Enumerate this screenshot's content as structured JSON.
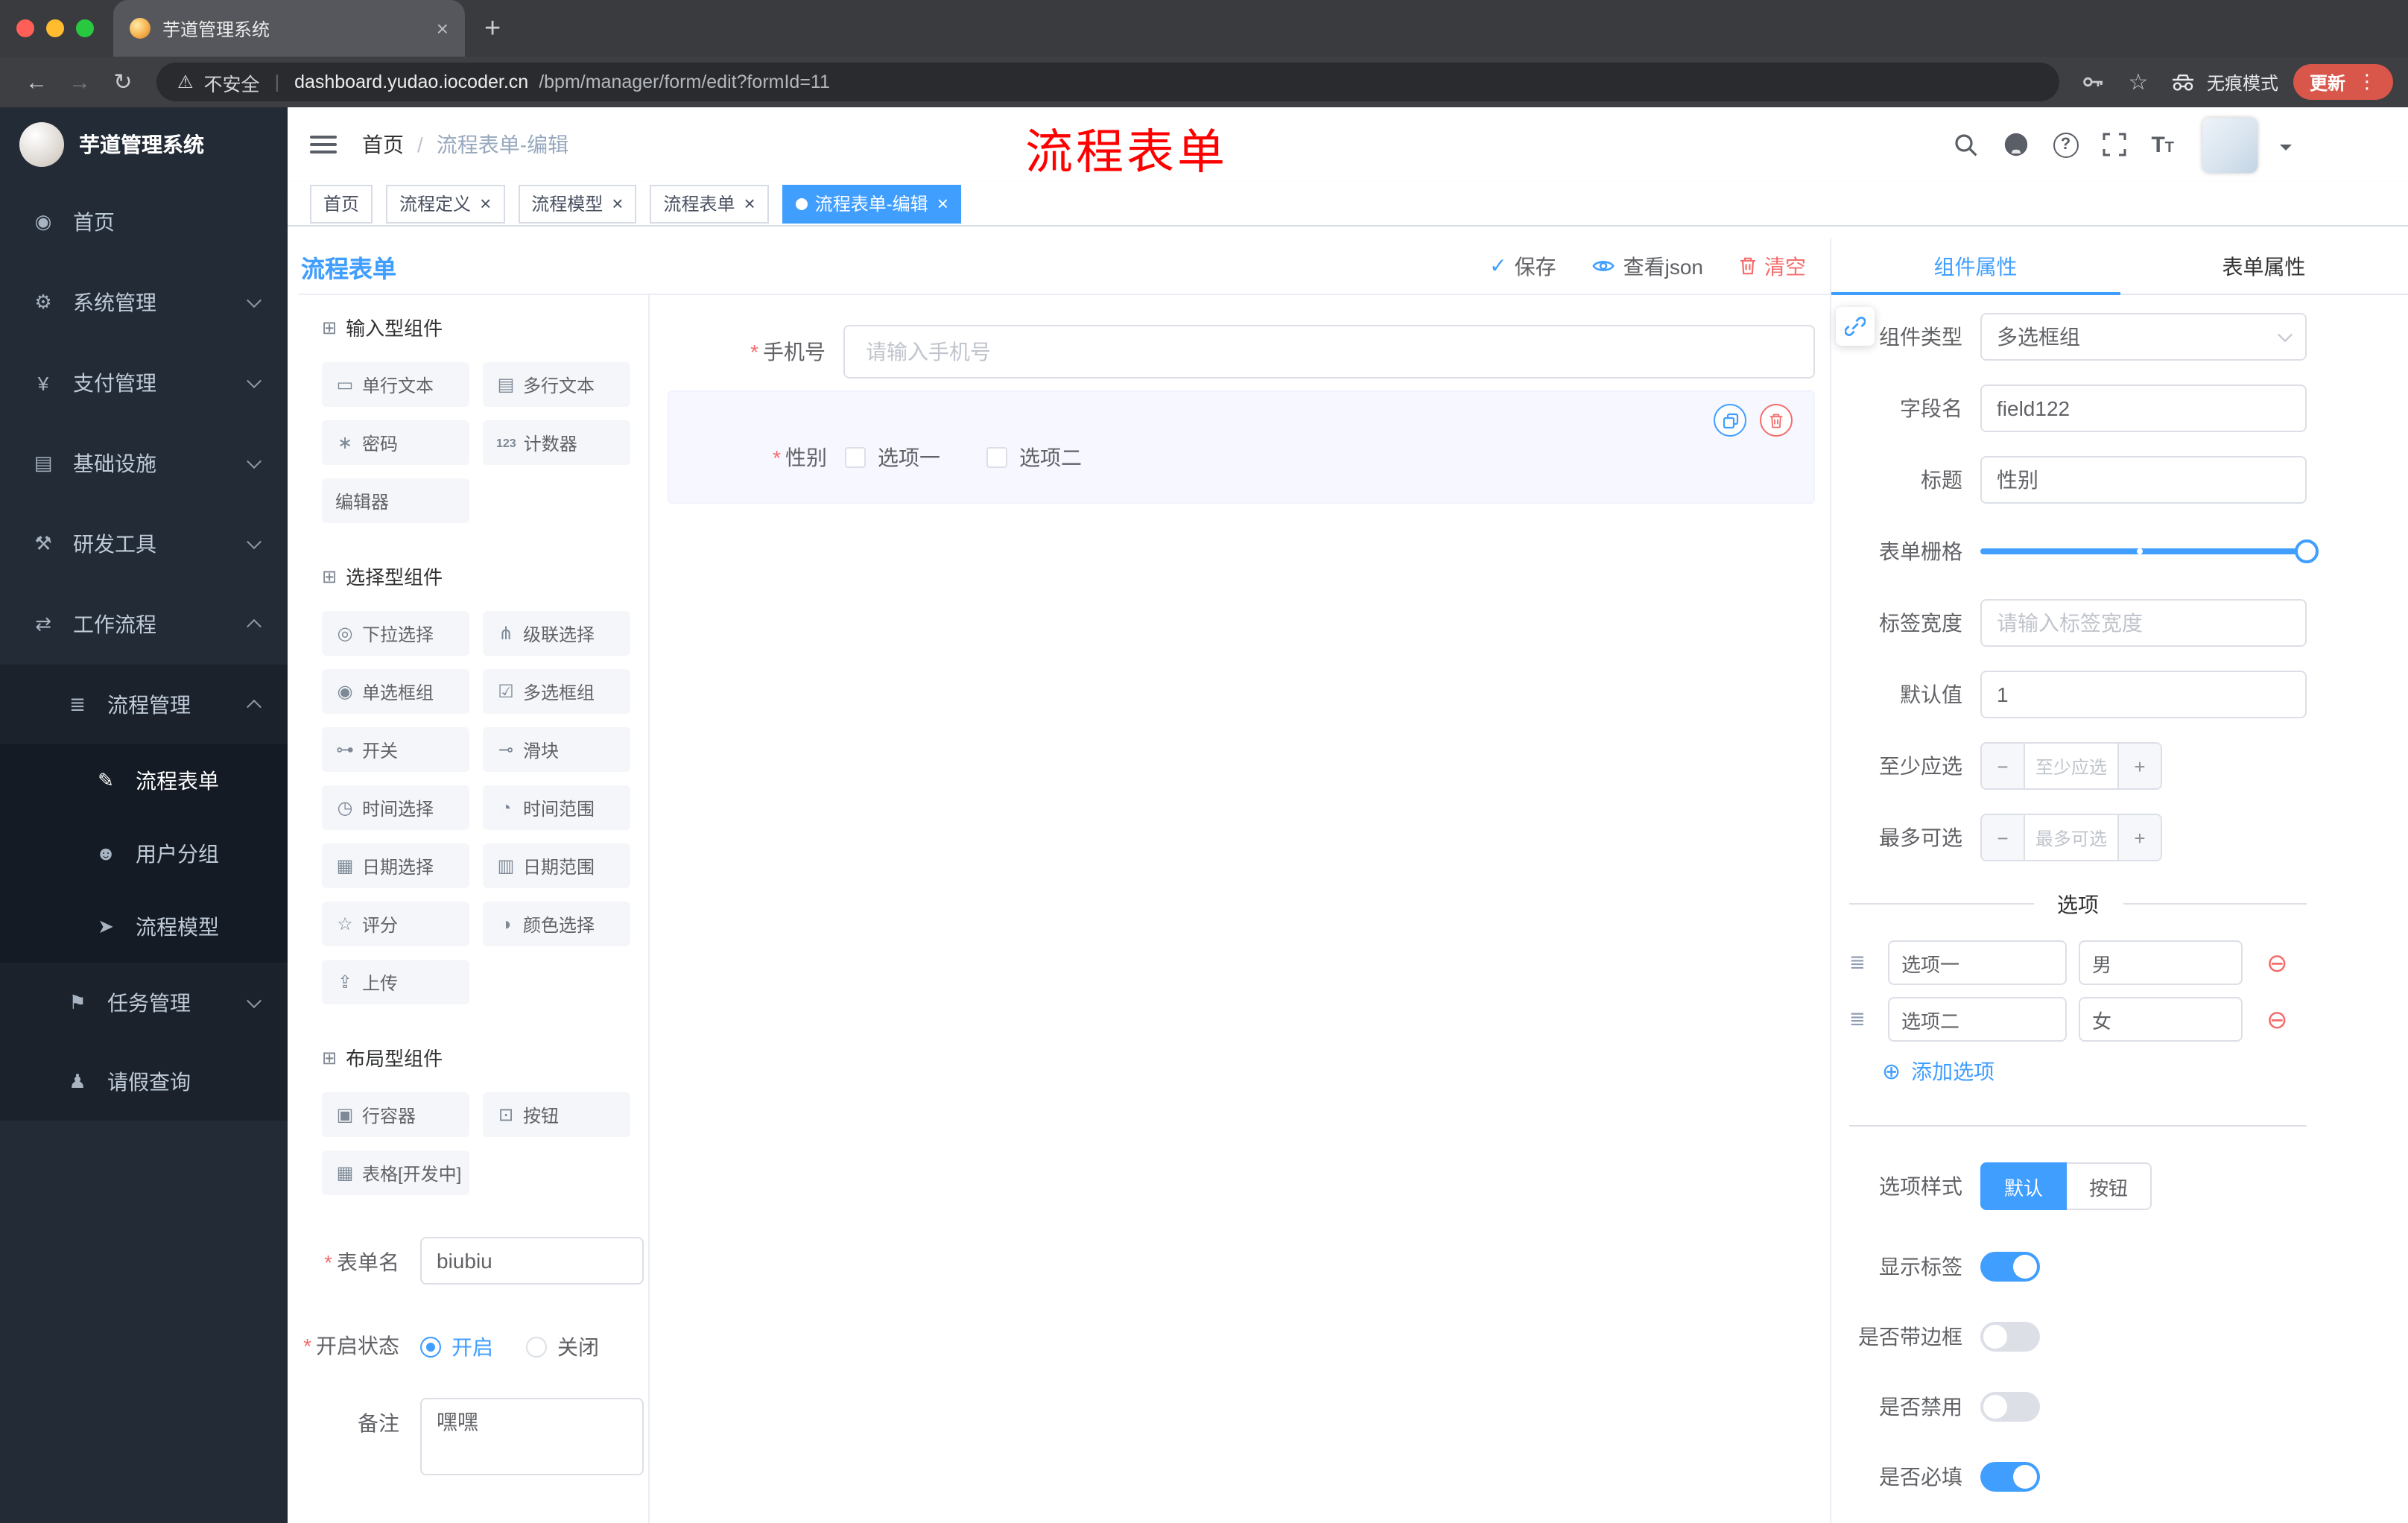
{
  "colors": {
    "accent": "#409EFF",
    "danger": "#F56C6C",
    "annotation": "#FF0000",
    "sidebar_bg": "#232B37"
  },
  "glyphs": {
    "back": "←",
    "forward": "→",
    "reload": "↻",
    "warning": "⚠",
    "pipe": "|",
    "star": "☆",
    "dots": "⋮",
    "new_tab": "+",
    "close": "×",
    "check": "✓",
    "question": "?",
    "minus": "−",
    "plus": "+",
    "add_circle": "⊕",
    "remove_circle": "⊖",
    "required": "*",
    "font_big": "T",
    "font_small": "T",
    "handle": "≣"
  },
  "browser": {
    "tab": {
      "title": "芋道管理系统"
    },
    "toolbar": {
      "security": "不安全",
      "url_domain": "dashboard.yudao.iocoder.cn",
      "url_path": "/bpm/manager/form/edit?formId=11",
      "incognito": "无痕模式",
      "update": "更新"
    }
  },
  "sidebar": {
    "brand": "芋道管理系统",
    "menu": [
      {
        "key": "home",
        "label": "首页",
        "icon": "◉",
        "icon_name": "dashboard-icon",
        "level": 1
      },
      {
        "key": "system",
        "label": "系统管理",
        "icon": "⚙",
        "icon_name": "gear-icon",
        "level": 1,
        "chevron": "down"
      },
      {
        "key": "payment",
        "label": "支付管理",
        "icon": "¥",
        "icon_name": "yen-icon",
        "level": 1,
        "chevron": "down"
      },
      {
        "key": "infrastructure",
        "label": "基础设施",
        "icon": "▤",
        "icon_name": "infrastructure-icon",
        "level": 1,
        "chevron": "down"
      },
      {
        "key": "dev-tools",
        "label": "研发工具",
        "icon": "⚒",
        "icon_name": "tools-icon",
        "level": 1,
        "chevron": "down"
      },
      {
        "key": "workflow",
        "label": "工作流程",
        "icon": "⇄",
        "icon_name": "workflow-icon",
        "level": 1,
        "chevron": "up"
      },
      {
        "key": "process-management",
        "label": "流程管理",
        "icon": "≣",
        "icon_name": "process-list-icon",
        "level": 2,
        "chevron": "up"
      },
      {
        "key": "process-form",
        "label": "流程表单",
        "icon": "✎",
        "icon_name": "form-icon",
        "level": 3,
        "active": true
      },
      {
        "key": "user-group",
        "label": "用户分组",
        "icon": "☻",
        "icon_name": "user-group-icon",
        "level": 3
      },
      {
        "key": "process-model",
        "label": "流程模型",
        "icon": "➤",
        "icon_name": "model-icon",
        "level": 3
      },
      {
        "key": "task-management",
        "label": "任务管理",
        "icon": "⚑",
        "icon_name": "task-icon",
        "level": 2,
        "chevron": "down"
      },
      {
        "key": "leave-query",
        "label": "请假查询",
        "icon": "♟",
        "icon_name": "person-icon",
        "level": 2
      }
    ]
  },
  "header": {
    "breadcrumb_home": "首页",
    "breadcrumb_sep": "/",
    "breadcrumb_current": "流程表单-编辑",
    "annotation": "流程表单"
  },
  "tags": [
    {
      "label": "首页",
      "closable": false,
      "active": false
    },
    {
      "label": "流程定义",
      "closable": true,
      "active": false
    },
    {
      "label": "流程模型",
      "closable": true,
      "active": false
    },
    {
      "label": "流程表单",
      "closable": true,
      "active": false
    },
    {
      "label": "流程表单-编辑",
      "closable": true,
      "active": true
    }
  ],
  "designer": {
    "title": "流程表单",
    "actions": {
      "save": "保存",
      "view_json": "查看json",
      "clear": "清空"
    },
    "palette_icon": "⊞",
    "palette": [
      {
        "title": "输入型组件",
        "items": [
          {
            "label": "单行文本",
            "icon": "▭",
            "icon_name": "single-line-text-icon"
          },
          {
            "label": "多行文本",
            "icon": "▤",
            "icon_name": "textarea-icon"
          },
          {
            "label": "密码",
            "icon": "∗",
            "icon_name": "password-icon"
          },
          {
            "label": "计数器",
            "icon": "123",
            "icon_name": "counter-icon"
          },
          {
            "label": "编辑器",
            "icon": "",
            "icon_name": "editor-icon"
          }
        ]
      },
      {
        "title": "选择型组件",
        "items": [
          {
            "label": "下拉选择",
            "icon": "◎",
            "icon_name": "select-icon"
          },
          {
            "label": "级联选择",
            "icon": "⋔",
            "icon_name": "cascader-icon"
          },
          {
            "label": "单选框组",
            "icon": "◉",
            "icon_name": "radio-group-icon"
          },
          {
            "label": "多选框组",
            "icon": "☑",
            "icon_name": "checkbox-group-icon"
          },
          {
            "label": "开关",
            "icon": "⊶",
            "icon_name": "switch-icon"
          },
          {
            "label": "滑块",
            "icon": "⊸",
            "icon_name": "slider-icon"
          },
          {
            "label": "时间选择",
            "icon": "◷",
            "icon_name": "time-picker-icon"
          },
          {
            "label": "时间范围",
            "icon": "◔",
            "icon_name": "time-range-icon"
          },
          {
            "label": "日期选择",
            "icon": "▦",
            "icon_name": "date-picker-icon"
          },
          {
            "label": "日期范围",
            "icon": "▥",
            "icon_name": "date-range-icon"
          },
          {
            "label": "评分",
            "icon": "☆",
            "icon_name": "rate-icon"
          },
          {
            "label": "颜色选择",
            "icon": "◑",
            "icon_name": "color-picker-icon"
          },
          {
            "label": "上传",
            "icon": "⇪",
            "icon_name": "upload-icon"
          }
        ]
      },
      {
        "title": "布局型组件",
        "items": [
          {
            "label": "行容器",
            "icon": "▣",
            "icon_name": "row-container-icon"
          },
          {
            "label": "按钮",
            "icon": "⊡",
            "icon_name": "button-icon"
          },
          {
            "label": "表格[开发中]",
            "icon": "▦",
            "icon_name": "table-icon"
          }
        ]
      }
    ],
    "meta": {
      "name_label": "表单名",
      "name_value": "biubiu",
      "status_label": "开启状态",
      "status_on": "开启",
      "status_off": "关闭",
      "remark_label": "备注",
      "remark_value": "嘿嘿"
    },
    "canvas": {
      "phone_label": "手机号",
      "phone_placeholder": "请输入手机号",
      "gender_label": "性别",
      "gender_options": [
        "选项一",
        "选项二"
      ]
    }
  },
  "props": {
    "tab_component": "组件属性",
    "tab_form": "表单属性",
    "type_label": "组件类型",
    "type_value": "多选框组",
    "field_label": "字段名",
    "field_value": "field122",
    "title_label": "标题",
    "title_value": "性别",
    "grid_label": "表单栅格",
    "labelwidth_label": "标签宽度",
    "labelwidth_placeholder": "请输入标签宽度",
    "default_label": "默认值",
    "default_value": "1",
    "min_label": "至少应选",
    "min_placeholder": "至少应选",
    "max_label": "最多可选",
    "max_placeholder": "最多可选",
    "options_divider": "选项",
    "options": [
      {
        "label": "选项一",
        "value": "男"
      },
      {
        "label": "选项二",
        "value": "女"
      }
    ],
    "add_option": "添加选项",
    "style_label": "选项样式",
    "style_default": "默认",
    "style_button": "按钮",
    "switches": [
      {
        "label": "显示标签",
        "on": true
      },
      {
        "label": "是否带边框",
        "on": false
      },
      {
        "label": "是否禁用",
        "on": false
      },
      {
        "label": "是否必填",
        "on": true
      }
    ]
  }
}
